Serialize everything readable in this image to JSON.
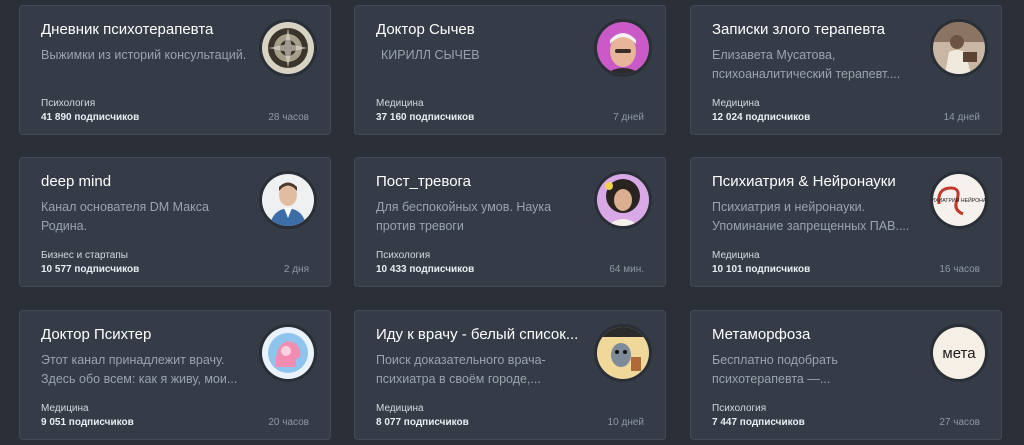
{
  "channels": [
    {
      "title": "Дневник психотерапевта",
      "desc": "Выжимки из историй консультаций.",
      "category": "Психология",
      "subscribers": "41 890 подписчиков",
      "time": "28 часов",
      "avatar": "escher-pattern-icon"
    },
    {
      "title": "Доктор Сычев",
      "desc": "КИРИЛЛ СЫЧЕВ",
      "category": "Медицина",
      "subscribers": "37 160 подписчиков",
      "time": "7 дней",
      "avatar": "man-portrait-icon"
    },
    {
      "title": "Записки злого терапевта",
      "desc": "Елизавета Мусатова, психоаналитический терапевт....",
      "category": "Медицина",
      "subscribers": "12 024 подписчиков",
      "time": "14 дней",
      "avatar": "vintage-photo-icon"
    },
    {
      "title": "deep mind",
      "desc": "Канал основателя DM Макса Родина.",
      "category": "Бизнес и стартапы",
      "subscribers": "10 577 подписчиков",
      "time": "2 дня",
      "avatar": "man-portrait-icon"
    },
    {
      "title": "Пост_тревога",
      "desc": "Для беспокойных умов. Наука против тревоги",
      "category": "Психология",
      "subscribers": "10 433 подписчиков",
      "time": "64 мин.",
      "avatar": "woman-portrait-icon"
    },
    {
      "title": "Психиатрия & Нейронауки",
      "desc": "Психиатрия и нейронауки. Упоминание запрещенных ПАВ....",
      "category": "Медицина",
      "subscribers": "10 101 подписчиков",
      "time": "16 часов",
      "avatar": "text-logo-icon",
      "logo_text": "ПСИХИАТРИЯ НЕЙРОНАУКИ"
    },
    {
      "title": "Доктор Психтер",
      "desc": "Этот канал принадлежит врачу. Здесь обо всем: как я живу, мои...",
      "category": "Медицина",
      "subscribers": "9 051 подписчиков",
      "time": "20 часов",
      "avatar": "head-illustration-icon"
    },
    {
      "title": "Иду к врачу - белый список...",
      "desc": "Поиск доказательного врача-психиатра в своём городе,...",
      "category": "Медицина",
      "subscribers": "8 077 подписчиков",
      "time": "10 дней",
      "avatar": "cartoon-icon"
    },
    {
      "title": "Метаморфоза",
      "desc": "Бесплатно подобрать психотерапевта —...",
      "category": "Психология",
      "subscribers": "7 447 подписчиков",
      "time": "27 часов",
      "avatar": "text-logo-icon",
      "logo_text": "мета"
    }
  ]
}
